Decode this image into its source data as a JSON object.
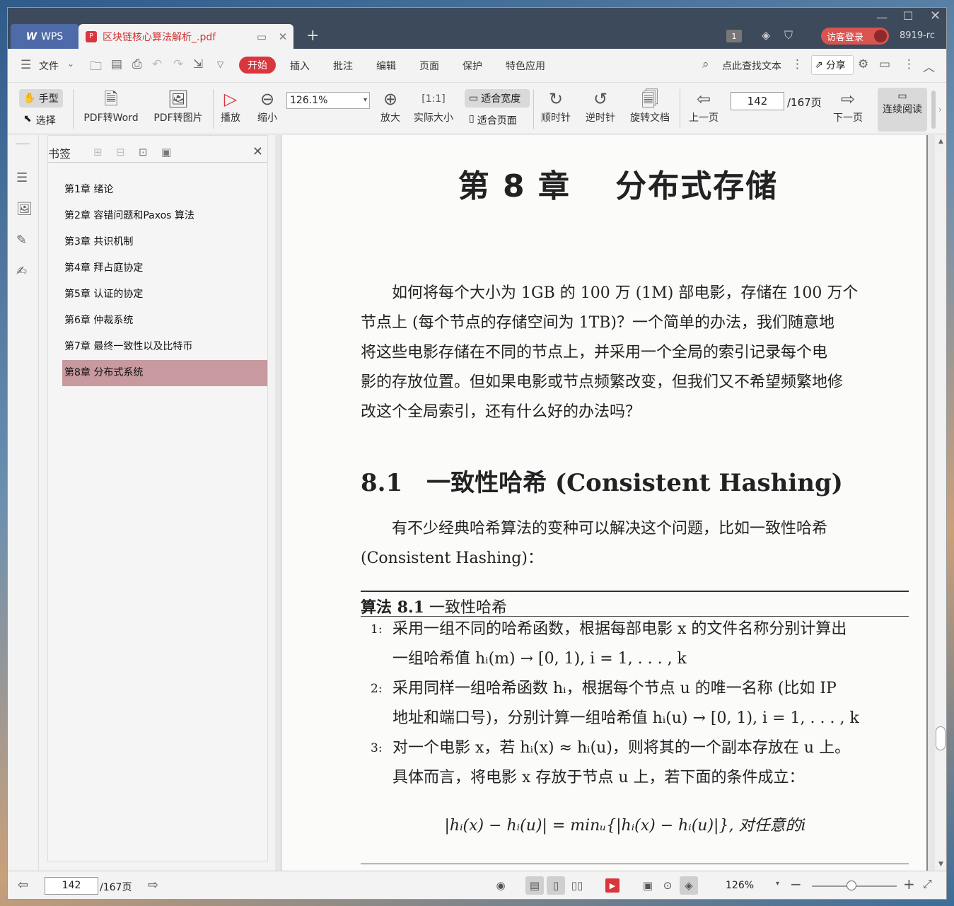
{
  "titlebar": {
    "app_tab": "WPS",
    "doc_tab": "区块链核心算法解析_.pdf",
    "badge": "1",
    "guest_login": "访客登录",
    "user_id": "8919-rc"
  },
  "menubar": {
    "file": "文件",
    "tabs": [
      "开始",
      "插入",
      "批注",
      "编辑",
      "页面",
      "保护",
      "特色应用"
    ],
    "search": "点此查找文本",
    "share": "分享"
  },
  "toolbar": {
    "hand": "手型",
    "select": "选择",
    "pdf_to_word": "PDF转Word",
    "pdf_to_image": "PDF转图片",
    "play": "播放",
    "zoom_out": "缩小",
    "zoom_value": "126.1%",
    "zoom_in": "放大",
    "actual_size": "实际大小",
    "fit_width": "适合宽度",
    "fit_page": "适合页面",
    "rotate_cw": "顺时针",
    "rotate_ccw": "逆时针",
    "rotate_doc": "旋转文档",
    "prev_page": "上一页",
    "page_current": "142",
    "page_total": "/167页",
    "next_page": "下一页",
    "continuous": "连续阅读"
  },
  "bookmarks": {
    "title": "书签",
    "items": [
      "第1章 绪论",
      "第2章 容错问题和Paxos 算法",
      "第3章 共识机制",
      "第4章 拜占庭协定",
      "第5章 认证的协定",
      "第6章 仲裁系统",
      "第7章 最终一致性以及比特币",
      "第8章 分布式系统"
    ],
    "active_index": 7
  },
  "page": {
    "chapter": "第 8 章　 分布式存储",
    "intro_lines": [
      "　　如何将每个大小为 1GB 的 100 万 (1M) 部电影，存储在 100 万个",
      "节点上 (每个节点的存储空间为 1TB)？一个简单的办法，我们随意地",
      "将这些电影存储在不同的节点上，并采用一个全局的索引记录每个电",
      "影的存放位置。但如果电影或节点频繁改变，但我们又不希望频繁地修",
      "改这个全局索引，还有什么好的办法吗？"
    ],
    "section": "8.1　一致性哈希 (Consistent Hashing)",
    "section_intro_lines": [
      "　　有不少经典哈希算法的变种可以解决这个问题，比如一致性哈希",
      "(Consistent Hashing)："
    ],
    "algorithm_label": "算法 8.1",
    "algorithm_name": "一致性哈希",
    "steps": [
      {
        "num": "1:",
        "lines": [
          "采用一组不同的哈希函数，根据每部电影 x 的文件名称分别计算出",
          "一组哈希值 hᵢ(m) → [0, 1), i = 1, . . . , k"
        ]
      },
      {
        "num": "2:",
        "lines": [
          "采用同样一组哈希函数 hᵢ，根据每个节点 u 的唯一名称 (比如 IP",
          "地址和端口号)，分别计算一组哈希值 hᵢ(u) → [0, 1), i = 1, . . . , k"
        ]
      },
      {
        "num": "3:",
        "lines": [
          "对一个电影 x，若 hᵢ(x) ≈ hᵢ(u)，则将其的一个副本存放在 u 上。",
          "具体而言，将电影 x 存放于节点 u 上，若下面的条件成立："
        ]
      }
    ],
    "formula": "|hᵢ(x) − hᵢ(u)| = minᵤ{|hᵢ(x) − hᵢ(u)|}, 对任意的i"
  },
  "statusbar": {
    "page_current": "142",
    "page_total": "/167页",
    "zoom": "126%"
  }
}
